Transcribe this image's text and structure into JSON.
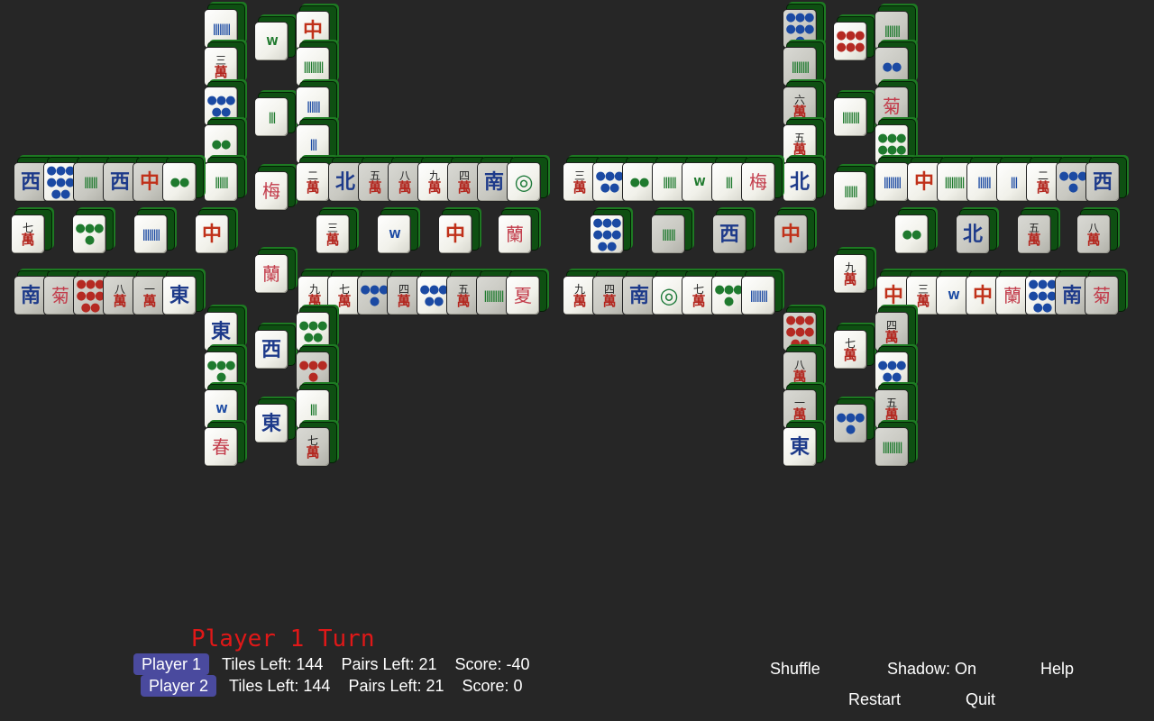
{
  "game": {
    "turn_text": "Player 1 Turn"
  },
  "players": [
    {
      "name": "Player 1",
      "tiles_left": "Tiles Left: 144",
      "pairs_left": "Pairs Left: 21",
      "score": "Score: -40",
      "active": true
    },
    {
      "name": "Player 2",
      "tiles_left": "Tiles Left: 144",
      "pairs_left": "Pairs Left: 21",
      "score": "Score: 0",
      "active": false
    }
  ],
  "menu": {
    "shuffle": "Shuffle",
    "shadow": "Shadow: On",
    "help": "Help",
    "restart": "Restart",
    "quit": "Quit"
  },
  "tiles": [
    {
      "glyph": "||||||||",
      "kind": "bam-b",
      "dim": false
    },
    {
      "glyph": "三萬",
      "kind": "wan",
      "dim": false
    },
    {
      "glyph": "●●●●●",
      "kind": "dots",
      "dim": false
    },
    {
      "glyph": "●●",
      "kind": "dots-g",
      "dim": false
    },
    {
      "glyph": "||||||",
      "kind": "bam",
      "dim": false
    },
    {
      "glyph": "W",
      "kind": "bam",
      "dim": false
    },
    {
      "glyph": "|||",
      "kind": "bam",
      "dim": false
    },
    {
      "glyph": "梅",
      "kind": "flower",
      "dim": false
    },
    {
      "glyph": "中",
      "kind": "red",
      "dim": false
    },
    {
      "glyph": "|||||||||",
      "kind": "bam",
      "dim": false
    },
    {
      "glyph": "||||||",
      "kind": "bam-b",
      "dim": false
    },
    {
      "glyph": "|||",
      "kind": "bam-b",
      "dim": false
    },
    {
      "glyph": "二萬",
      "kind": "wan",
      "dim": false
    },
    {
      "glyph": "●●●●",
      "kind": "dots",
      "dim": true
    },
    {
      "glyph": "西",
      "kind": "blue",
      "dim": true
    },
    {
      "glyph": "●●●●●●●●",
      "kind": "dots",
      "dim": false
    },
    {
      "glyph": "||||||",
      "kind": "bam",
      "dim": true
    },
    {
      "glyph": "西",
      "kind": "blue",
      "dim": true
    },
    {
      "glyph": "中",
      "kind": "red",
      "dim": true
    },
    {
      "glyph": "●●",
      "kind": "dots-g",
      "dim": false
    },
    {
      "glyph": "北",
      "kind": "blue",
      "dim": true
    },
    {
      "glyph": "五萬",
      "kind": "wan",
      "dim": true
    },
    {
      "glyph": "八萬",
      "kind": "wan",
      "dim": true
    },
    {
      "glyph": "九萬",
      "kind": "wan",
      "dim": false
    },
    {
      "glyph": "四萬",
      "kind": "wan",
      "dim": true
    },
    {
      "glyph": "南",
      "kind": "blue",
      "dim": true
    },
    {
      "glyph": "◎",
      "kind": "circle",
      "dim": false
    },
    {
      "glyph": "七萬",
      "kind": "wan",
      "dim": false
    },
    {
      "glyph": "●●●●",
      "kind": "dots-g",
      "dim": false
    },
    {
      "glyph": "||||||||",
      "kind": "bam-b",
      "dim": false
    },
    {
      "glyph": "中",
      "kind": "red",
      "dim": false
    },
    {
      "glyph": "三萬",
      "kind": "wan",
      "dim": false
    },
    {
      "glyph": "W",
      "kind": "bam-b",
      "dim": false
    },
    {
      "glyph": "中",
      "kind": "red",
      "dim": false
    },
    {
      "glyph": "蘭",
      "kind": "flower",
      "dim": false
    },
    {
      "glyph": "●●●●●●●●",
      "kind": "dots",
      "dim": false
    },
    {
      "glyph": "南",
      "kind": "blue",
      "dim": true
    },
    {
      "glyph": "菊",
      "kind": "flower",
      "dim": true
    },
    {
      "glyph": "●●●●●●●●",
      "kind": "dots-r",
      "dim": true
    },
    {
      "glyph": "八萬",
      "kind": "wan",
      "dim": true
    },
    {
      "glyph": "一萬",
      "kind": "wan",
      "dim": true
    },
    {
      "glyph": "東",
      "kind": "blue",
      "dim": false
    },
    {
      "glyph": "九萬",
      "kind": "wan",
      "dim": false
    },
    {
      "glyph": "七萬",
      "kind": "wan",
      "dim": false
    },
    {
      "glyph": "●●●●",
      "kind": "dots",
      "dim": true
    },
    {
      "glyph": "四萬",
      "kind": "wan",
      "dim": true
    },
    {
      "glyph": "●●●●●",
      "kind": "dots",
      "dim": false
    },
    {
      "glyph": "五萬",
      "kind": "wan",
      "dim": true
    },
    {
      "glyph": "|||||||||",
      "kind": "bam",
      "dim": true
    },
    {
      "glyph": "夏",
      "kind": "flower",
      "dim": false
    },
    {
      "glyph": "東",
      "kind": "blue",
      "dim": false
    },
    {
      "glyph": "●●●●",
      "kind": "dots-g",
      "dim": false
    },
    {
      "glyph": "W",
      "kind": "bam-b",
      "dim": false
    },
    {
      "glyph": "春",
      "kind": "flower",
      "dim": false
    },
    {
      "glyph": "蘭",
      "kind": "flower",
      "dim": false
    },
    {
      "glyph": "西",
      "kind": "blue",
      "dim": false
    },
    {
      "glyph": "東",
      "kind": "blue",
      "dim": false
    },
    {
      "glyph": "●●●●●",
      "kind": "dots-g",
      "dim": false
    },
    {
      "glyph": "●●●●",
      "kind": "dots-r",
      "dim": true
    },
    {
      "glyph": "|||",
      "kind": "bam",
      "dim": false
    },
    {
      "glyph": "七萬",
      "kind": "wan",
      "dim": true
    },
    {
      "glyph": "●●●●●●●",
      "kind": "dots",
      "dim": true
    },
    {
      "glyph": "||||||||",
      "kind": "bam",
      "dim": true
    },
    {
      "glyph": "六萬",
      "kind": "wan",
      "dim": true
    },
    {
      "glyph": "五萬",
      "kind": "wan",
      "dim": false
    },
    {
      "glyph": "北",
      "kind": "blue",
      "dim": false
    },
    {
      "glyph": "●●●●●●",
      "kind": "dots-r",
      "dim": false
    },
    {
      "glyph": "||||||||",
      "kind": "bam",
      "dim": false
    },
    {
      "glyph": "||||||",
      "kind": "bam",
      "dim": false
    },
    {
      "glyph": "|||||||",
      "kind": "bam",
      "dim": true
    },
    {
      "glyph": "●●",
      "kind": "dots",
      "dim": true
    },
    {
      "glyph": "菊",
      "kind": "flower",
      "dim": true
    },
    {
      "glyph": "●●●●●●",
      "kind": "dots-g",
      "dim": false
    }
  ]
}
